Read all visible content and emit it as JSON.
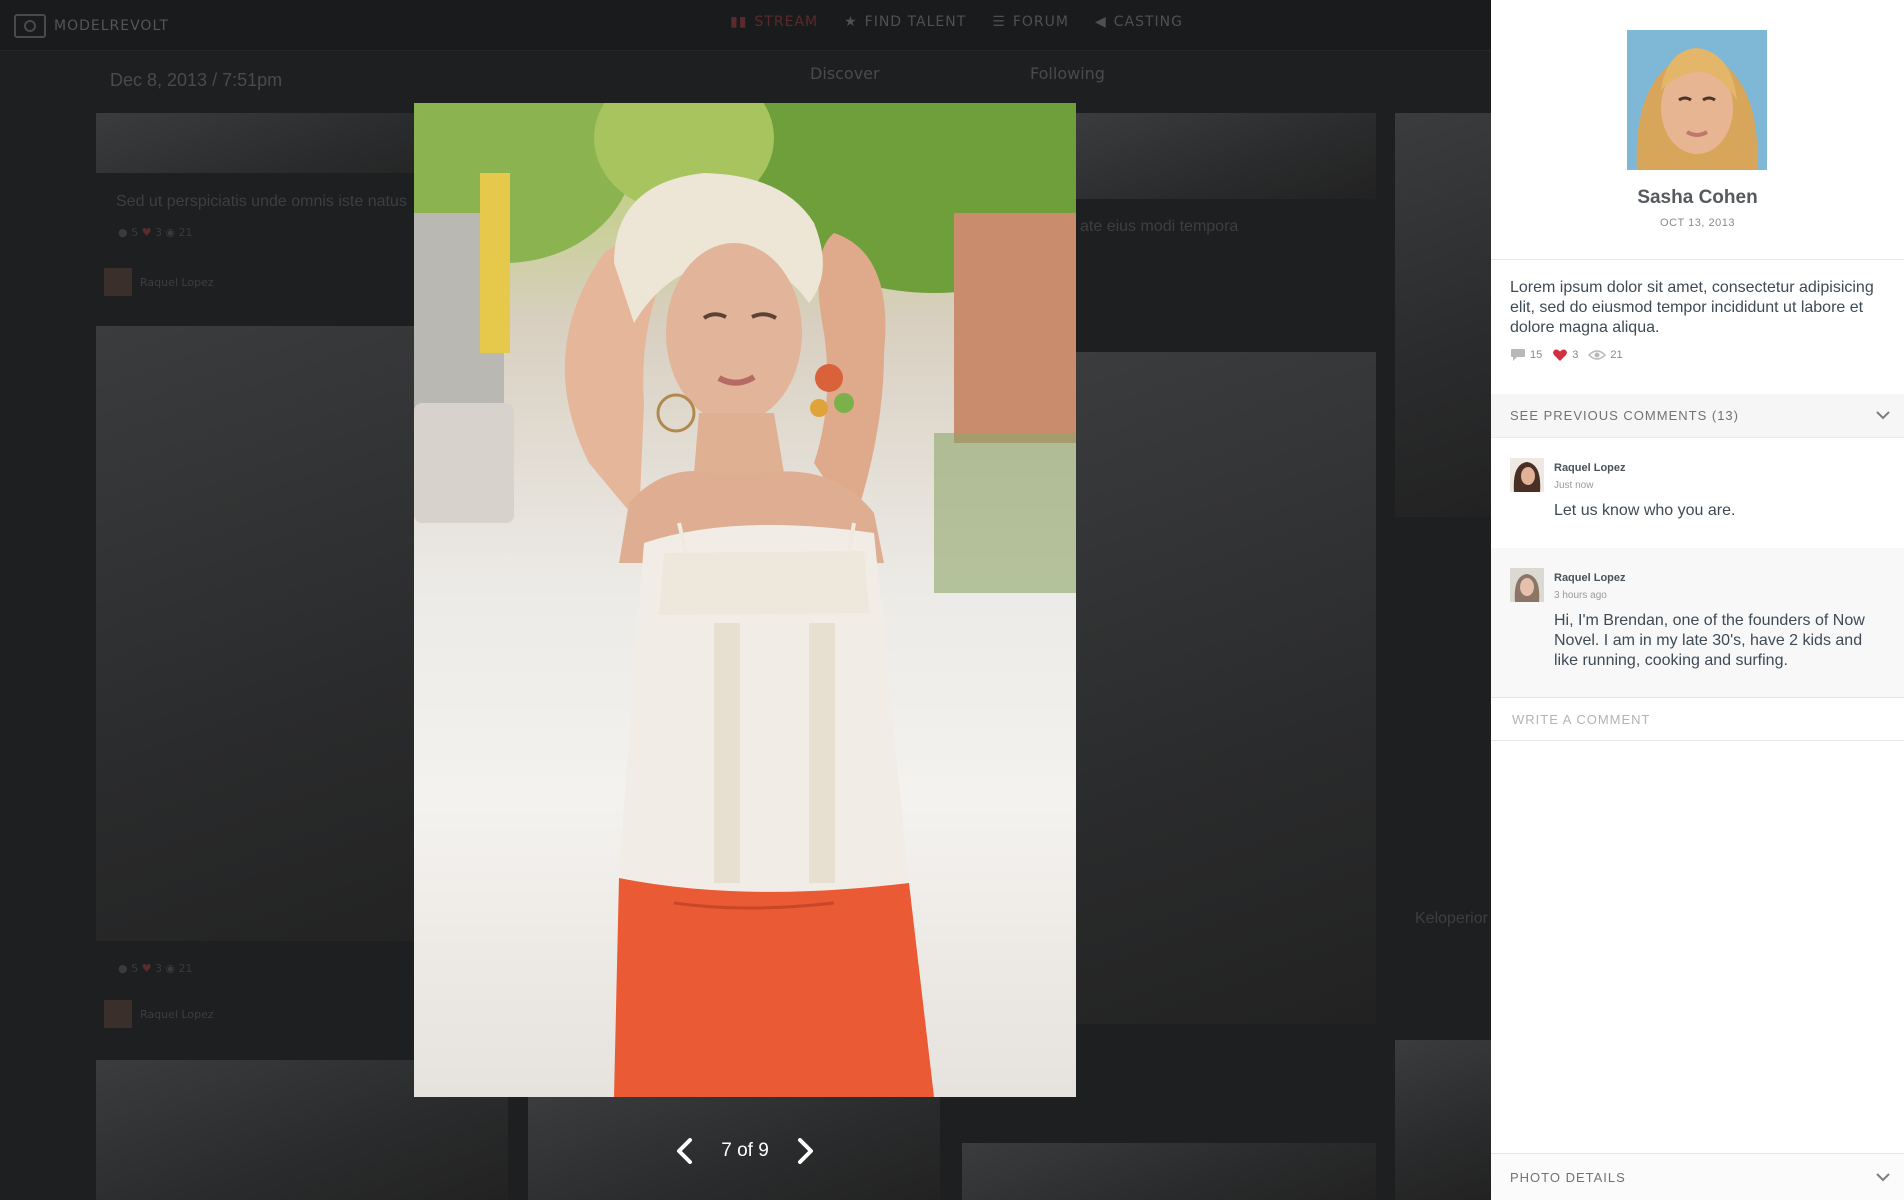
{
  "app": {
    "logo_text": "MODELREVOLT"
  },
  "nav": [
    {
      "label": "STREAM",
      "icon": "stream-icon",
      "active": true
    },
    {
      "label": "FIND TALENT",
      "icon": "star-icon"
    },
    {
      "label": "FORUM",
      "icon": "list-icon"
    },
    {
      "label": "CASTING",
      "icon": "megaphone-icon"
    }
  ],
  "background": {
    "post_date": "Dec 8, 2013 / 7:51pm",
    "segments": [
      {
        "label": "Discover"
      },
      {
        "label": "Following"
      }
    ],
    "card_text_1": "Sed ut perspiciatis unde omnis iste natus",
    "card_text_2": "ate eius modi tempora",
    "card_text_3": "Keloperior",
    "author": "Raquel Lopez"
  },
  "lightbox": {
    "counter": "7 of 9",
    "prev_icon": "chevron-left-icon",
    "next_icon": "chevron-right-icon"
  },
  "sidebar": {
    "profile_name": "Sasha Cohen",
    "profile_date": "OCT 13, 2013",
    "description": "Lorem ipsum dolor sit amet, consectetur adipisicing elit, sed do eiusmod tempor incididunt ut labore et dolore magna aliqua.",
    "stats": {
      "comments": "15",
      "likes": "3",
      "views": "21"
    },
    "previous_comments_label": "SEE PREVIOUS COMMENTS (13)",
    "comments": [
      {
        "author": "Raquel Lopez",
        "time": "Just now",
        "text": "Let us know who you are."
      },
      {
        "author": "Raquel Lopez",
        "time": "3 hours ago",
        "text": "Hi, I'm Brendan, one of the founders of Now Novel. I am in my late 30's, have 2 kids and like running, cooking and surfing."
      }
    ],
    "write_placeholder": "Write a comment",
    "photo_details_label": "PHOTO DETAILS"
  },
  "colors": {
    "accent_heart": "#d0303f",
    "overlay": "#151617"
  }
}
